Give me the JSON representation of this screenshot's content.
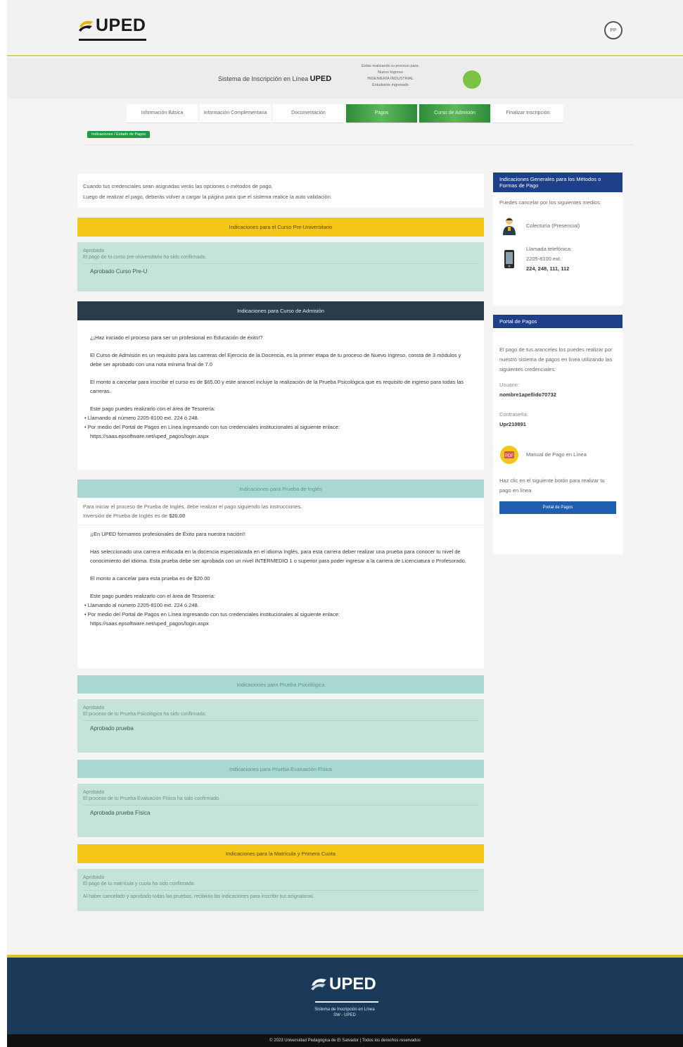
{
  "header": {
    "logo_text": "UPED",
    "avatar_initials": "PP"
  },
  "system": {
    "title_prefix": "Sistema de Inscripción en Línea",
    "title_brand": "UPED",
    "info_lines": [
      "Estás realizando tu proceso para:",
      "Nuevo Ingreso",
      "INGENIERÍA INDUSTRIAL",
      "Estudiante ingresado"
    ],
    "status_color": "#7bc143"
  },
  "steps": [
    {
      "label": "Información Básica",
      "active": false
    },
    {
      "label": "Información Complementaria",
      "active": false
    },
    {
      "label": "Documentación",
      "active": false
    },
    {
      "label": "Pagos",
      "active": true
    },
    {
      "label": "Curso de Admisión",
      "active": true
    },
    {
      "label": "Finalizar Inscripción",
      "active": false
    }
  ],
  "breadcrumb": "Indicaciones / Estado de Pagos",
  "intro": {
    "line1": "Cuando tus credenciales sean asignadas verás las opciones o métodos de pago.",
    "line2": "Luego de realizar el pago, deberás volver a cargar la página para que el sistema realice la auto validación."
  },
  "preuni": {
    "bar": "Indicaciones para el Curso Pre-Universitario",
    "status_label": "Aprobado",
    "status_text": "El pago de tu curso pre-universitario ha sido confirmado.",
    "status_ok": "Aprobado Curso Pre-U"
  },
  "admision": {
    "bar": "Indicaciones para Curso de Admisión",
    "p1": "¿¡Haz iniciado el proceso para ser un profesional en Educación de éxito!?",
    "p2": "El Curso de Admisión es un requisito para las carreras del Ejercicio de la Docencia, es la primer etapa de tu proceso de Nuevo Ingreso, consta de 3 módulos y debe ser aprobado con una nota mínima final de 7.0",
    "p3": "El monto a cancelar para inscribir el curso es de $65.00 y este arancel incluye la realización de la Prueba Psicológica que es requisito de ingreso para todas las carreras.",
    "p4": "Este pago puedes realizarlo con el área de Tesorería:",
    "li1": "Llamando al número 2205-8100 ext. 224 ó 248.",
    "li2": "Por medio del Portal de Pagos en Línea ingresando con tus credenciales institucionales al siguiente enlace:",
    "link": "https://saas.epsoftware.net/uped_pagos/login.aspx"
  },
  "ingles": {
    "bar": "Indicaciones para Prueba de Inglés",
    "intro1": "Para iniciar el proceso de Prueba de Inglés, debe realizar el pago siguiendo las instrucciones.",
    "intro2": "Inversión de Prueba de Inglés es de",
    "amount": "$20.00",
    "p1": "¡¡En UPED formamos profesionales de Éxito para nuestra nación!!",
    "p2": "Has seleccionado una carrera enfocada en la docencia especializada en el idioma Inglés, para esta carrera deber realizar una prueba para conocer tu nivel de conocimiento del idioma. Esta prueba debe ser aprobada con un nivel INTERMEDIO 1 o superior para poder ingresar a la carrera de Licenciatura o Profesorado.",
    "p3": "El monto a cancelar para esta prueba es de $20.00",
    "p4": "Este pago puedes realizarlo con el área de Tesorería:",
    "li1": "Llamando al número 2205-8100 ext. 224 ó 248.",
    "li2": "Por medio del Portal de Pagos en Línea ingresando con tus credenciales institucionales al siguiente enlace:",
    "link": "https://saas.epsoftware.net/uped_pagos/login.aspx"
  },
  "psico": {
    "bar": "Indicaciones para Prueba Psicológica",
    "status_label": "Aprobado",
    "status_text": "El proceso de tu Prueba Psicológica ha sido confirmado.",
    "status_ok": "Aprobado prueba"
  },
  "fisica": {
    "bar": "Indicaciones para Prueba Evaluación Física",
    "status_label": "Aprobado",
    "status_text": "El proceso de tu Prueba Evaluación Física ha sido confirmado.",
    "status_ok": "Aprobada prueba Física"
  },
  "matricula": {
    "bar": "Indicaciones para la Matrícula y Primera Cuota",
    "status_label": "Aprobado",
    "status_text": "El pago de tu matrícula y cuota ha sido confirmado.",
    "status_note": "Al haber cancelado y aprobado todas las pruebas, recibirás las indicaciones para inscribir tus asignaturas."
  },
  "sidebar": {
    "methods_title": "Indicaciones Generales para los Métodos o Formas de Pago",
    "methods_intro": "Puedes cancelar por los siguientes medios:",
    "method1": "Colecturía (Presencial)",
    "method2_line1": "Llamada telefónica:",
    "method2_line2": "2205-8100 ext.",
    "method2_line3": "224, 248, 111, 112",
    "portal_title": "Portal de Pagos",
    "portal_text": "El pago de tus aranceles los puedes realizar por nuestro sistema de pagos en línea utilizando las siguientes credenciales:",
    "user_label": "Usuario:",
    "user_value": "nombre1apellido70732",
    "pass_label": "Contraseña:",
    "pass_value": "Upr210891",
    "manual": "Manual de Pago en Línea",
    "click_text": "Haz clic en el siguiente botón para realizar tu pago en línea",
    "portal_button": "Portal de Pagos"
  },
  "footer": {
    "logo_text": "UPED",
    "sys_line1": "Sistema de Inscripción en Línea",
    "sys_line2": "SW - UPED",
    "copyright": "© 2023 Universidad Pedagógica de El Salvador | Todos los derechos reservados"
  },
  "colors": {
    "navy": "#2a3b4c",
    "yellow": "#f5c518",
    "teal": "#a8d8cf",
    "blue": "#1e3f8a",
    "green": "#1f9a45"
  }
}
